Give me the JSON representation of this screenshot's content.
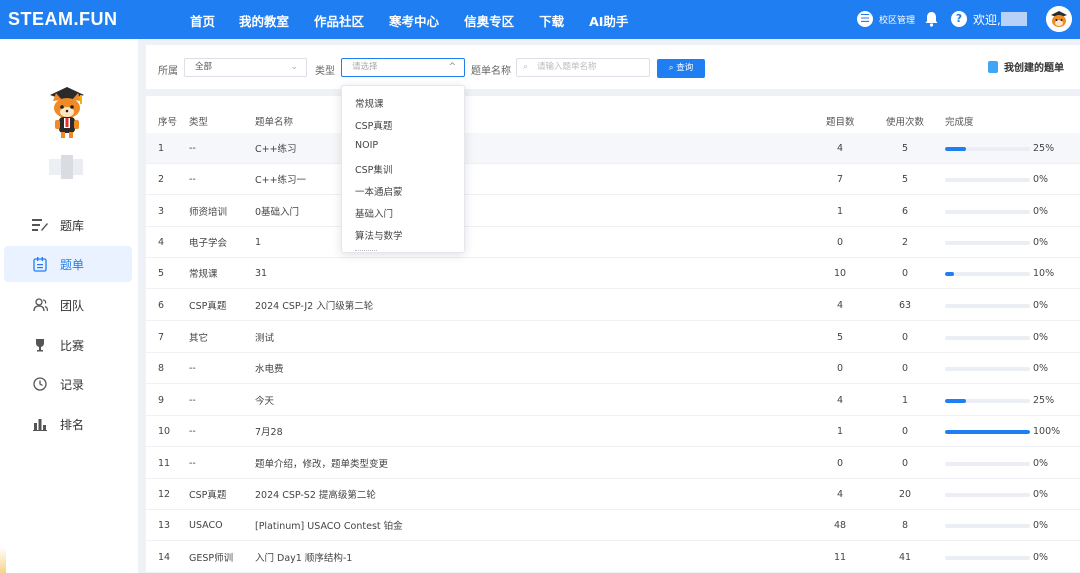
{
  "topbar": {
    "logo": "STEAM.FUN",
    "nav": [
      "首页",
      "我的教室",
      "作品社区",
      "寒考中心",
      "信奥专区",
      "下载",
      "AI助手"
    ],
    "campus_label": "校区管理",
    "welcome": "欢迎,"
  },
  "sidebar": {
    "items": [
      {
        "label": "题库",
        "icon": "question-bank-icon"
      },
      {
        "label": "题单",
        "icon": "list-icon"
      },
      {
        "label": "团队",
        "icon": "team-icon"
      },
      {
        "label": "比赛",
        "icon": "trophy-icon"
      },
      {
        "label": "记录",
        "icon": "clock-icon"
      },
      {
        "label": "排名",
        "icon": "ranking-icon"
      }
    ]
  },
  "filters": {
    "belong_label": "所属",
    "belong_value": "全部",
    "type_label": "类型",
    "type_placeholder": "请选择",
    "name_label": "题单名称",
    "name_placeholder": "请输入题单名称",
    "query_button": "查询",
    "my_lists": "我创建的题单"
  },
  "dropdown": {
    "options": [
      "常规课",
      "CSP真题",
      "NOIP",
      "CSP集训",
      "一本通启蒙",
      "基础入门",
      "算法与数学"
    ]
  },
  "table": {
    "headers": {
      "no": "序号",
      "type": "类型",
      "name": "题单名称",
      "qcount": "题目数",
      "uses": "使用次数",
      "progress": "完成度"
    },
    "rows": [
      {
        "no": "1",
        "type": "--",
        "name": "C++练习",
        "qcount": "4",
        "uses": "5",
        "progress": 25,
        "pct": "25%"
      },
      {
        "no": "2",
        "type": "--",
        "name": "C++练习一",
        "qcount": "7",
        "uses": "5",
        "progress": 0,
        "pct": "0%"
      },
      {
        "no": "3",
        "type": "师资培训",
        "name": "0基础入门",
        "qcount": "1",
        "uses": "6",
        "progress": 0,
        "pct": "0%"
      },
      {
        "no": "4",
        "type": "电子学会",
        "name": "1",
        "qcount": "0",
        "uses": "2",
        "progress": 0,
        "pct": "0%"
      },
      {
        "no": "5",
        "type": "常规课",
        "name": "31",
        "qcount": "10",
        "uses": "0",
        "progress": 10,
        "pct": "10%"
      },
      {
        "no": "6",
        "type": "CSP真题",
        "name": "2024 CSP-J2 入门级第二轮",
        "qcount": "4",
        "uses": "63",
        "progress": 0,
        "pct": "0%"
      },
      {
        "no": "7",
        "type": "其它",
        "name": "测试",
        "qcount": "5",
        "uses": "0",
        "progress": 0,
        "pct": "0%"
      },
      {
        "no": "8",
        "type": "--",
        "name": "水电费",
        "qcount": "0",
        "uses": "0",
        "progress": 0,
        "pct": "0%"
      },
      {
        "no": "9",
        "type": "--",
        "name": "今天",
        "qcount": "4",
        "uses": "1",
        "progress": 25,
        "pct": "25%"
      },
      {
        "no": "10",
        "type": "--",
        "name": "7月28",
        "qcount": "1",
        "uses": "0",
        "progress": 100,
        "pct": "100%"
      },
      {
        "no": "11",
        "type": "--",
        "name": "题单介绍，修改，题单类型变更",
        "qcount": "0",
        "uses": "0",
        "progress": 0,
        "pct": "0%"
      },
      {
        "no": "12",
        "type": "CSP真题",
        "name": "2024 CSP-S2 提高级第二轮",
        "qcount": "4",
        "uses": "20",
        "progress": 0,
        "pct": "0%"
      },
      {
        "no": "13",
        "type": "USACO",
        "name": "[Platinum] USACO Contest 铂金",
        "qcount": "48",
        "uses": "8",
        "progress": 0,
        "pct": "0%"
      },
      {
        "no": "14",
        "type": "GESP师训",
        "name": "入门 Day1 顺序结构-1",
        "qcount": "11",
        "uses": "41",
        "progress": 0,
        "pct": "0%"
      }
    ]
  },
  "colors": {
    "primary": "#1f7ef2"
  }
}
